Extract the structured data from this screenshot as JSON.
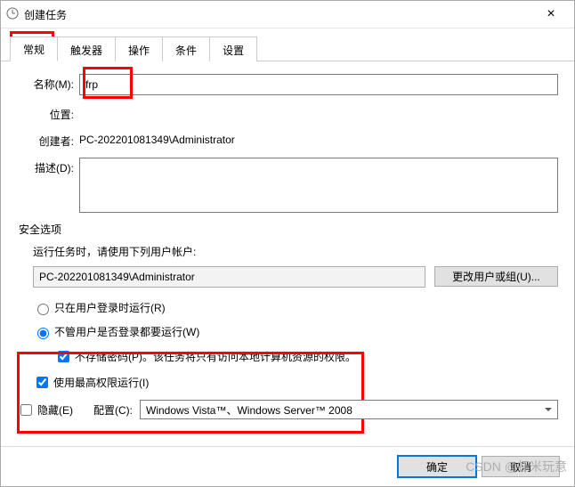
{
  "titlebar": {
    "title": "创建任务"
  },
  "tabs": {
    "general": "常规",
    "triggers": "触发器",
    "actions": "操作",
    "conditions": "条件",
    "settings": "设置"
  },
  "general": {
    "name_label": "名称(M):",
    "name_value": "frp",
    "location_label": "位置:",
    "location_value": "",
    "author_label": "创建者:",
    "author_value": "PC-202201081349\\Administrator",
    "description_label": "描述(D):",
    "description_value": ""
  },
  "security": {
    "title": "安全选项",
    "use_account_label": "运行任务时，请使用下列用户帐户:",
    "account_value": "PC-202201081349\\Administrator",
    "change_user_btn": "更改用户或组(U)...",
    "run_logged_on_label": "只在用户登录时运行(R)",
    "run_always_label": "不管用户是否登录都要运行(W)",
    "no_store_password_label": "不存储密码(P)。该任务将只有访问本地计算机资源的权限。",
    "highest_priv_label": "使用最高权限运行(I)"
  },
  "bottom": {
    "hidden_label": "隐藏(E)",
    "config_label": "配置(C):",
    "config_value": "Windows Vista™、Windows Server™ 2008"
  },
  "buttons": {
    "ok": "确定",
    "cancel": "取消"
  },
  "watermark": "CSDN @虾米玩意"
}
